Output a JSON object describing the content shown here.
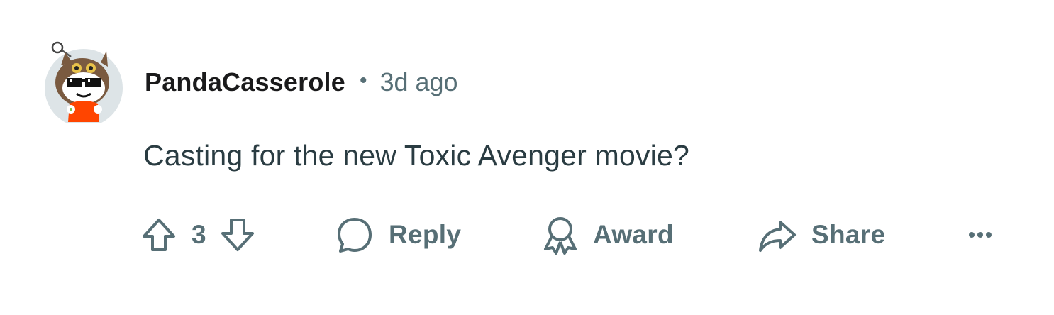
{
  "comment": {
    "username": "PandaCasserole",
    "separator": "•",
    "timestamp": "3d ago",
    "text": "Casting for the new Toxic Avenger movie?"
  },
  "actions": {
    "vote_count": "3",
    "reply_label": "Reply",
    "award_label": "Award",
    "share_label": "Share"
  },
  "icons": {
    "upvote": "upvote-arrow-icon",
    "downvote": "downvote-arrow-icon",
    "reply": "speech-bubble-icon",
    "award": "award-ribbon-icon",
    "share": "share-arrow-icon",
    "more": "ellipsis-icon"
  },
  "colors": {
    "icon_gray": "#576f76",
    "username": "#1a1a1b",
    "body_text": "#2a3c42",
    "avatar_bg": "#dde4e7",
    "avatar_shirt": "#ff4500"
  }
}
